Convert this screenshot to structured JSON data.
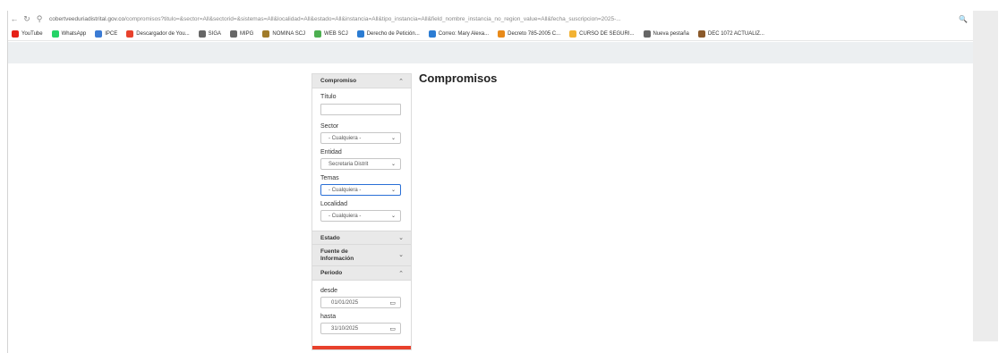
{
  "browser": {
    "url_host": "cobertveeduriadistrital.gov.co",
    "url_rest": "/compromisos?titulo=&sector=All&sectorid=&sistemas=All&localidad=All&estado=All&instancia=All&tipo_instancia=All&field_nombre_instancia_no_region_value=All&fecha_suscripcion=2025-...",
    "bookmarks": [
      {
        "label": "YouTube",
        "color": "#e62117"
      },
      {
        "label": "WhatsApp",
        "color": "#25d366"
      },
      {
        "label": "IPCE",
        "color": "#3b7bd4"
      },
      {
        "label": "Descargador de You...",
        "color": "#e8412c"
      },
      {
        "label": "SIGA",
        "color": "#666666"
      },
      {
        "label": "MIPG",
        "color": "#666666"
      },
      {
        "label": "NOMINA SCJ",
        "color": "#a07b2a"
      },
      {
        "label": "WEB SCJ",
        "color": "#4caf50"
      },
      {
        "label": "Derecho de Petición...",
        "color": "#2b7cd3"
      },
      {
        "label": "Correo: Mary Alexa...",
        "color": "#2b7cd3"
      },
      {
        "label": "Decreto 785-2005 C...",
        "color": "#e88a1a"
      },
      {
        "label": "CURSO DE SEGURI...",
        "color": "#f2b233"
      },
      {
        "label": "Nueva pestaña",
        "color": "#666666"
      },
      {
        "label": "DEC 1072 ACTUALIZ...",
        "color": "#8b5a2b"
      }
    ]
  },
  "page": {
    "title": "Compromisos"
  },
  "sidebar": {
    "compromiso": {
      "header": "Compromiso",
      "titulo_label": "Título",
      "titulo_value": "",
      "sector_label": "Sector",
      "sector_value": "- Cualquiera -",
      "entidad_label": "Entidad",
      "entidad_value": "Secretaria Distrit",
      "temas_label": "Temas",
      "temas_value": "- Cualquiera -",
      "localidad_label": "Localidad",
      "localidad_value": "- Cualquiera -"
    },
    "estado": {
      "header": "Estado"
    },
    "fuente": {
      "header": "Fuente de Información"
    },
    "periodo": {
      "header": "Periodo",
      "desde_label": "desde",
      "desde_value": "01/01/2025",
      "hasta_label": "hasta",
      "hasta_value": "31/10/2025"
    }
  },
  "colors": {
    "accent_red": "#e8412c",
    "focus_blue": "#2a6fd6"
  }
}
